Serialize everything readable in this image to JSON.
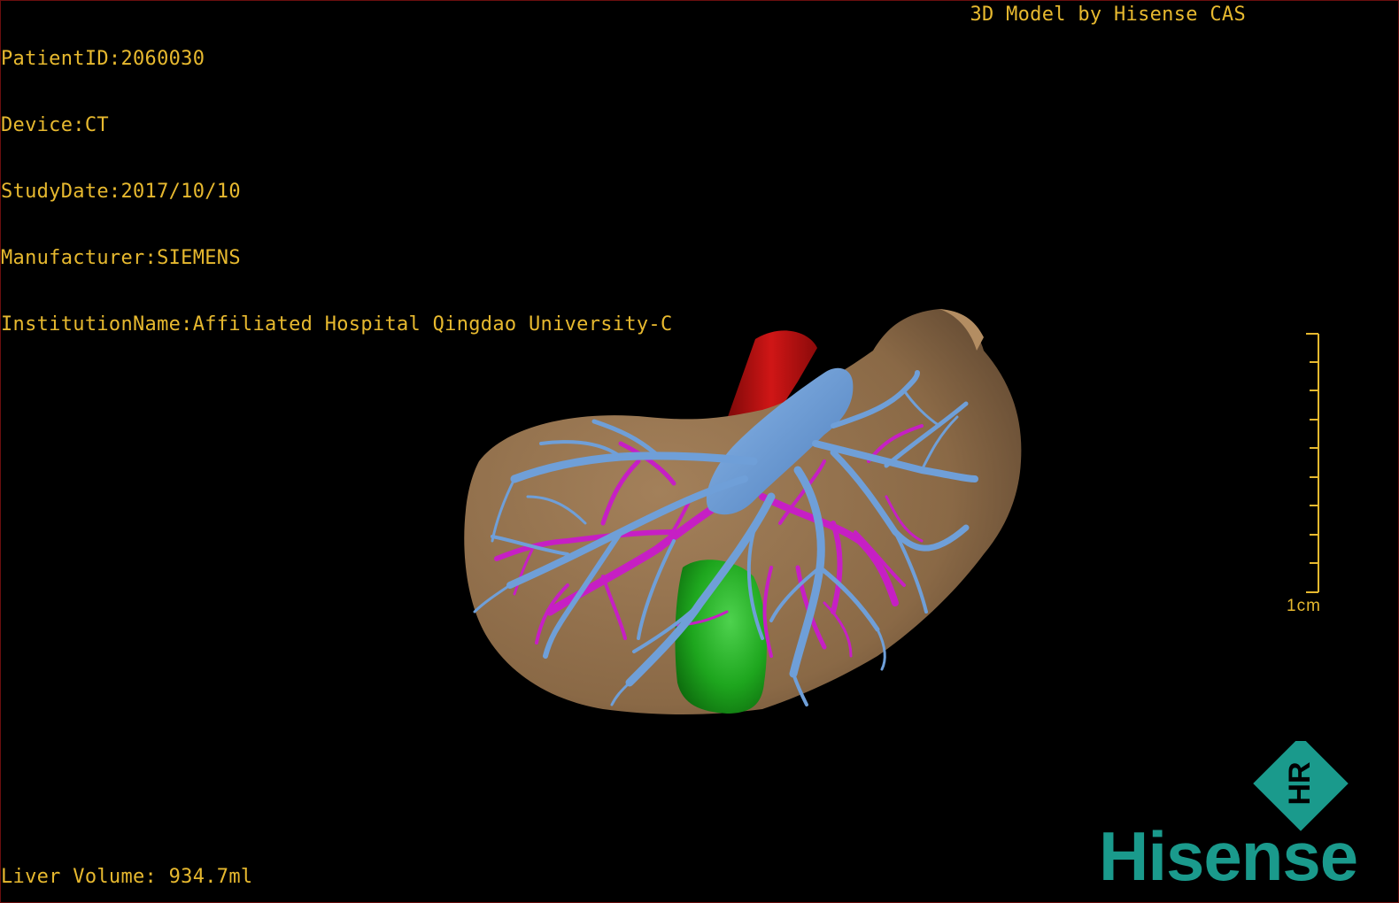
{
  "header": {
    "patient_id": "PatientID:2060030",
    "device": "Device:CT",
    "study_date": "StudyDate:2017/10/10",
    "manufacturer": "Manufacturer:SIEMENS",
    "institution": "InstitutionName:Affiliated Hospital Qingdao University-C",
    "model_credit": "3D Model by Hisense CAS"
  },
  "footer": {
    "liver_volume": "Liver Volume: 934.7ml"
  },
  "scale": {
    "label": "1cm"
  },
  "logo": {
    "brand": "Hisense",
    "emblem_letters": "HR",
    "color": "#1a9a8c"
  },
  "colors": {
    "overlay_text": "#e7b92f",
    "liver": "#8c6b47",
    "portal_vein": "#6f9fd8",
    "hepatic_artery": "#c61fc4",
    "ivc": "#c01010",
    "gallbladder": "#1fa51f"
  }
}
